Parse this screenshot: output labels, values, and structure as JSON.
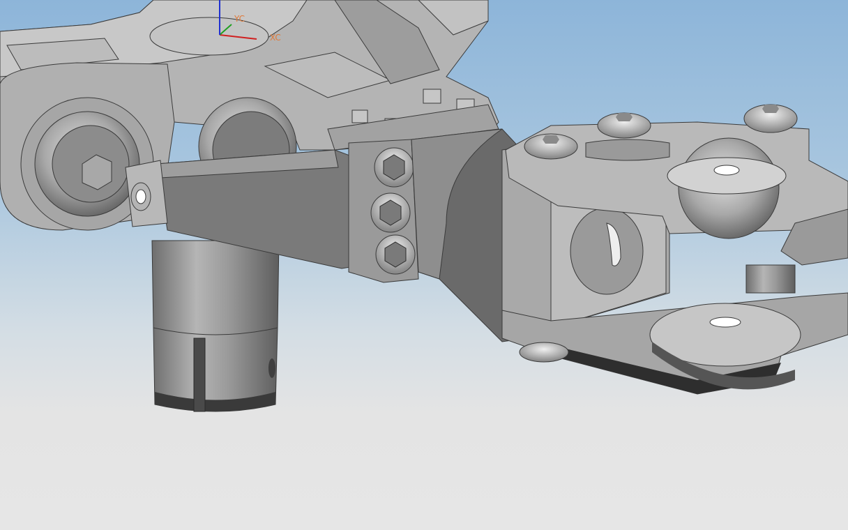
{
  "viewport": {
    "background_top": "#8db5d9",
    "background_bottom": "#e6e6e6",
    "model_color": "#a9a9a9"
  },
  "triad": {
    "xc_label": "XC",
    "yc_label": "YC",
    "x_color": "#d02020",
    "y_color": "#20a020",
    "z_color": "#2030d0"
  }
}
